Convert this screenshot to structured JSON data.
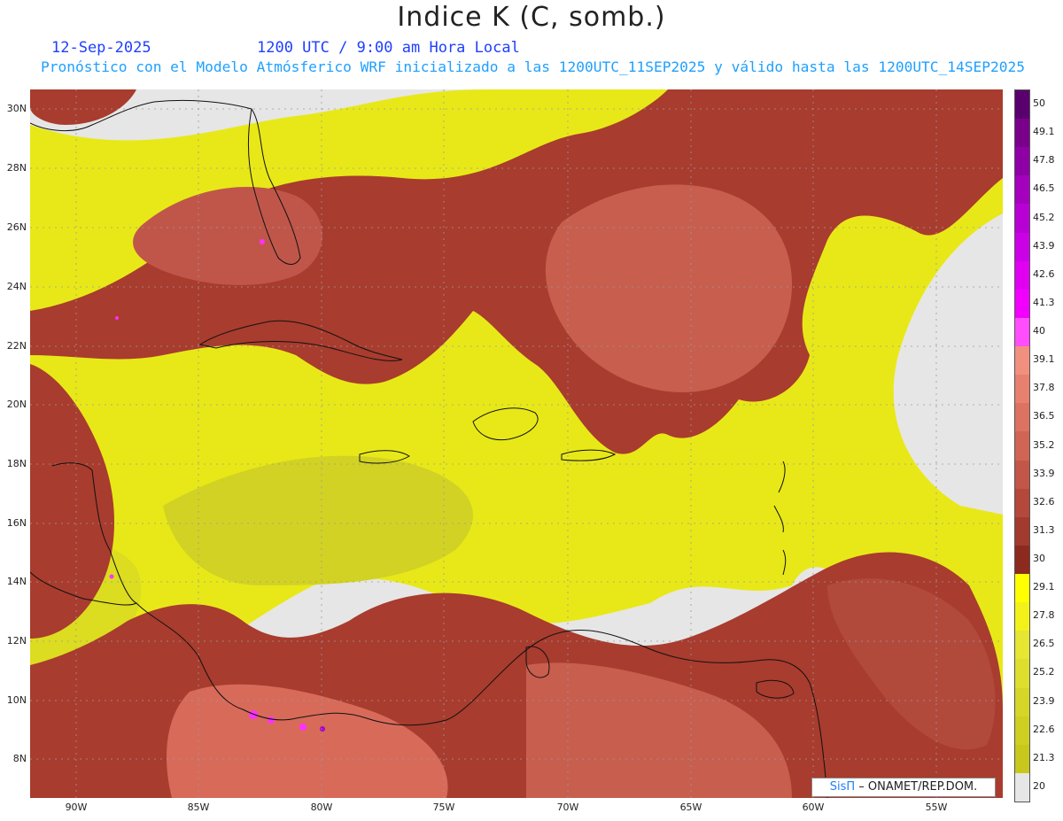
{
  "title": "Indice K (C, somb.)",
  "date": "12-Sep-2025",
  "time": "1200 UTC / 9:00 am Hora Local",
  "description": "Pronóstico con el Modelo Atmósferico WRF inicializado a las 1200UTC_11SEP2025 y válido hasta las  1200UTC_14SEP2025",
  "credit": {
    "brand": "SisΠ",
    "text": " – ONAMET/REP.DOM."
  },
  "map": {
    "lat_labels": [
      "30N",
      "28N",
      "26N",
      "24N",
      "22N",
      "20N",
      "18N",
      "16N",
      "14N",
      "12N",
      "10N",
      "8N"
    ],
    "lon_labels": [
      "90W",
      "85W",
      "80W",
      "75W",
      "70W",
      "65W",
      "60W",
      "55W"
    ]
  },
  "colorbar": {
    "labels": [
      "50",
      "49.1",
      "47.8",
      "46.5",
      "45.2",
      "43.9",
      "42.6",
      "41.3",
      "40",
      "39.1",
      "37.8",
      "36.5",
      "35.2",
      "33.9",
      "32.6",
      "31.3",
      "30",
      "29.1",
      "27.8",
      "26.5",
      "25.2",
      "23.9",
      "22.6",
      "21.3",
      "20"
    ],
    "colors": [
      "#5a006e",
      "#7a008c",
      "#8e00a6",
      "#a400be",
      "#b800d4",
      "#cc00e6",
      "#e000f2",
      "#f200ff",
      "#ff4dff",
      "#f29080",
      "#e88070",
      "#dc7262",
      "#d06455",
      "#c25648",
      "#b3483b",
      "#a23a2e",
      "#8c2a1e",
      "#ffff00",
      "#f2f21a",
      "#e6e633",
      "#dede2e",
      "#d6d628",
      "#cfcf22",
      "#c8c81c",
      "#e6e6e6"
    ]
  }
}
